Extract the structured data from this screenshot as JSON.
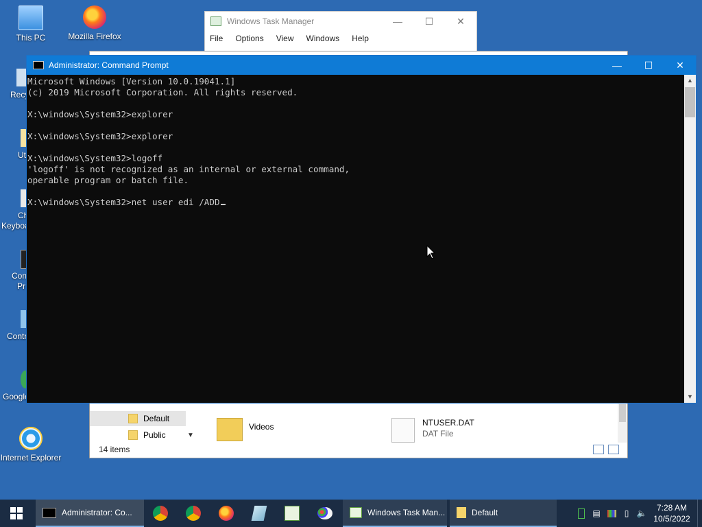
{
  "desktop": {
    "icons": [
      {
        "label": "This PC",
        "icon": "this-pc-icon"
      },
      {
        "label": "Mozilla Firefox",
        "icon": "firefox-icon"
      },
      {
        "label": "Internet Explorer",
        "icon": "internet-explorer-icon"
      }
    ],
    "partial_labels": [
      "Recy",
      "Ut",
      "Ch",
      "Keyboa",
      "Con",
      "Pr",
      "Contr",
      "Google"
    ]
  },
  "task_manager": {
    "title": "Windows Task Manager",
    "menu": [
      "File",
      "Options",
      "View",
      "Windows",
      "Help"
    ]
  },
  "explorer": {
    "nav": [
      {
        "label": "Default",
        "selected": true
      },
      {
        "label": "Public",
        "selected": false
      }
    ],
    "files": [
      {
        "name": "Videos"
      },
      {
        "name": "NTUSER.DAT",
        "type": "DAT File"
      }
    ],
    "status": "14 items"
  },
  "cmd": {
    "title": "Administrator: Command Prompt",
    "lines": [
      "Microsoft Windows [Version 10.0.19041.1]",
      "(c) 2019 Microsoft Corporation. All rights reserved.",
      "",
      "X:\\windows\\System32>explorer",
      "",
      "X:\\windows\\System32>explorer",
      "",
      "X:\\windows\\System32>logoff",
      "'logoff' is not recognized as an internal or external command,",
      "operable program or batch file.",
      "",
      "X:\\windows\\System32>net user edi /ADD"
    ]
  },
  "taskbar": {
    "buttons": [
      {
        "label": "Administrator: Co...",
        "state": "active"
      },
      {
        "label": "Windows Task Man...",
        "state": "open"
      },
      {
        "label": "Default",
        "state": "open"
      }
    ],
    "pinned": [
      "chrome-icon",
      "chrome-icon",
      "firefox-icon",
      "notepad-icon",
      "task-manager-icon",
      "paint-icon"
    ],
    "clock": {
      "time": "7:28 AM",
      "date": "10/5/2022"
    }
  },
  "colors": {
    "desktop": "#2d6ab3",
    "cmd_title": "#0f7bd6",
    "cmd_bg": "#0c0c0c",
    "cmd_text": "#cccccc",
    "taskbar": "#1b2c43"
  }
}
